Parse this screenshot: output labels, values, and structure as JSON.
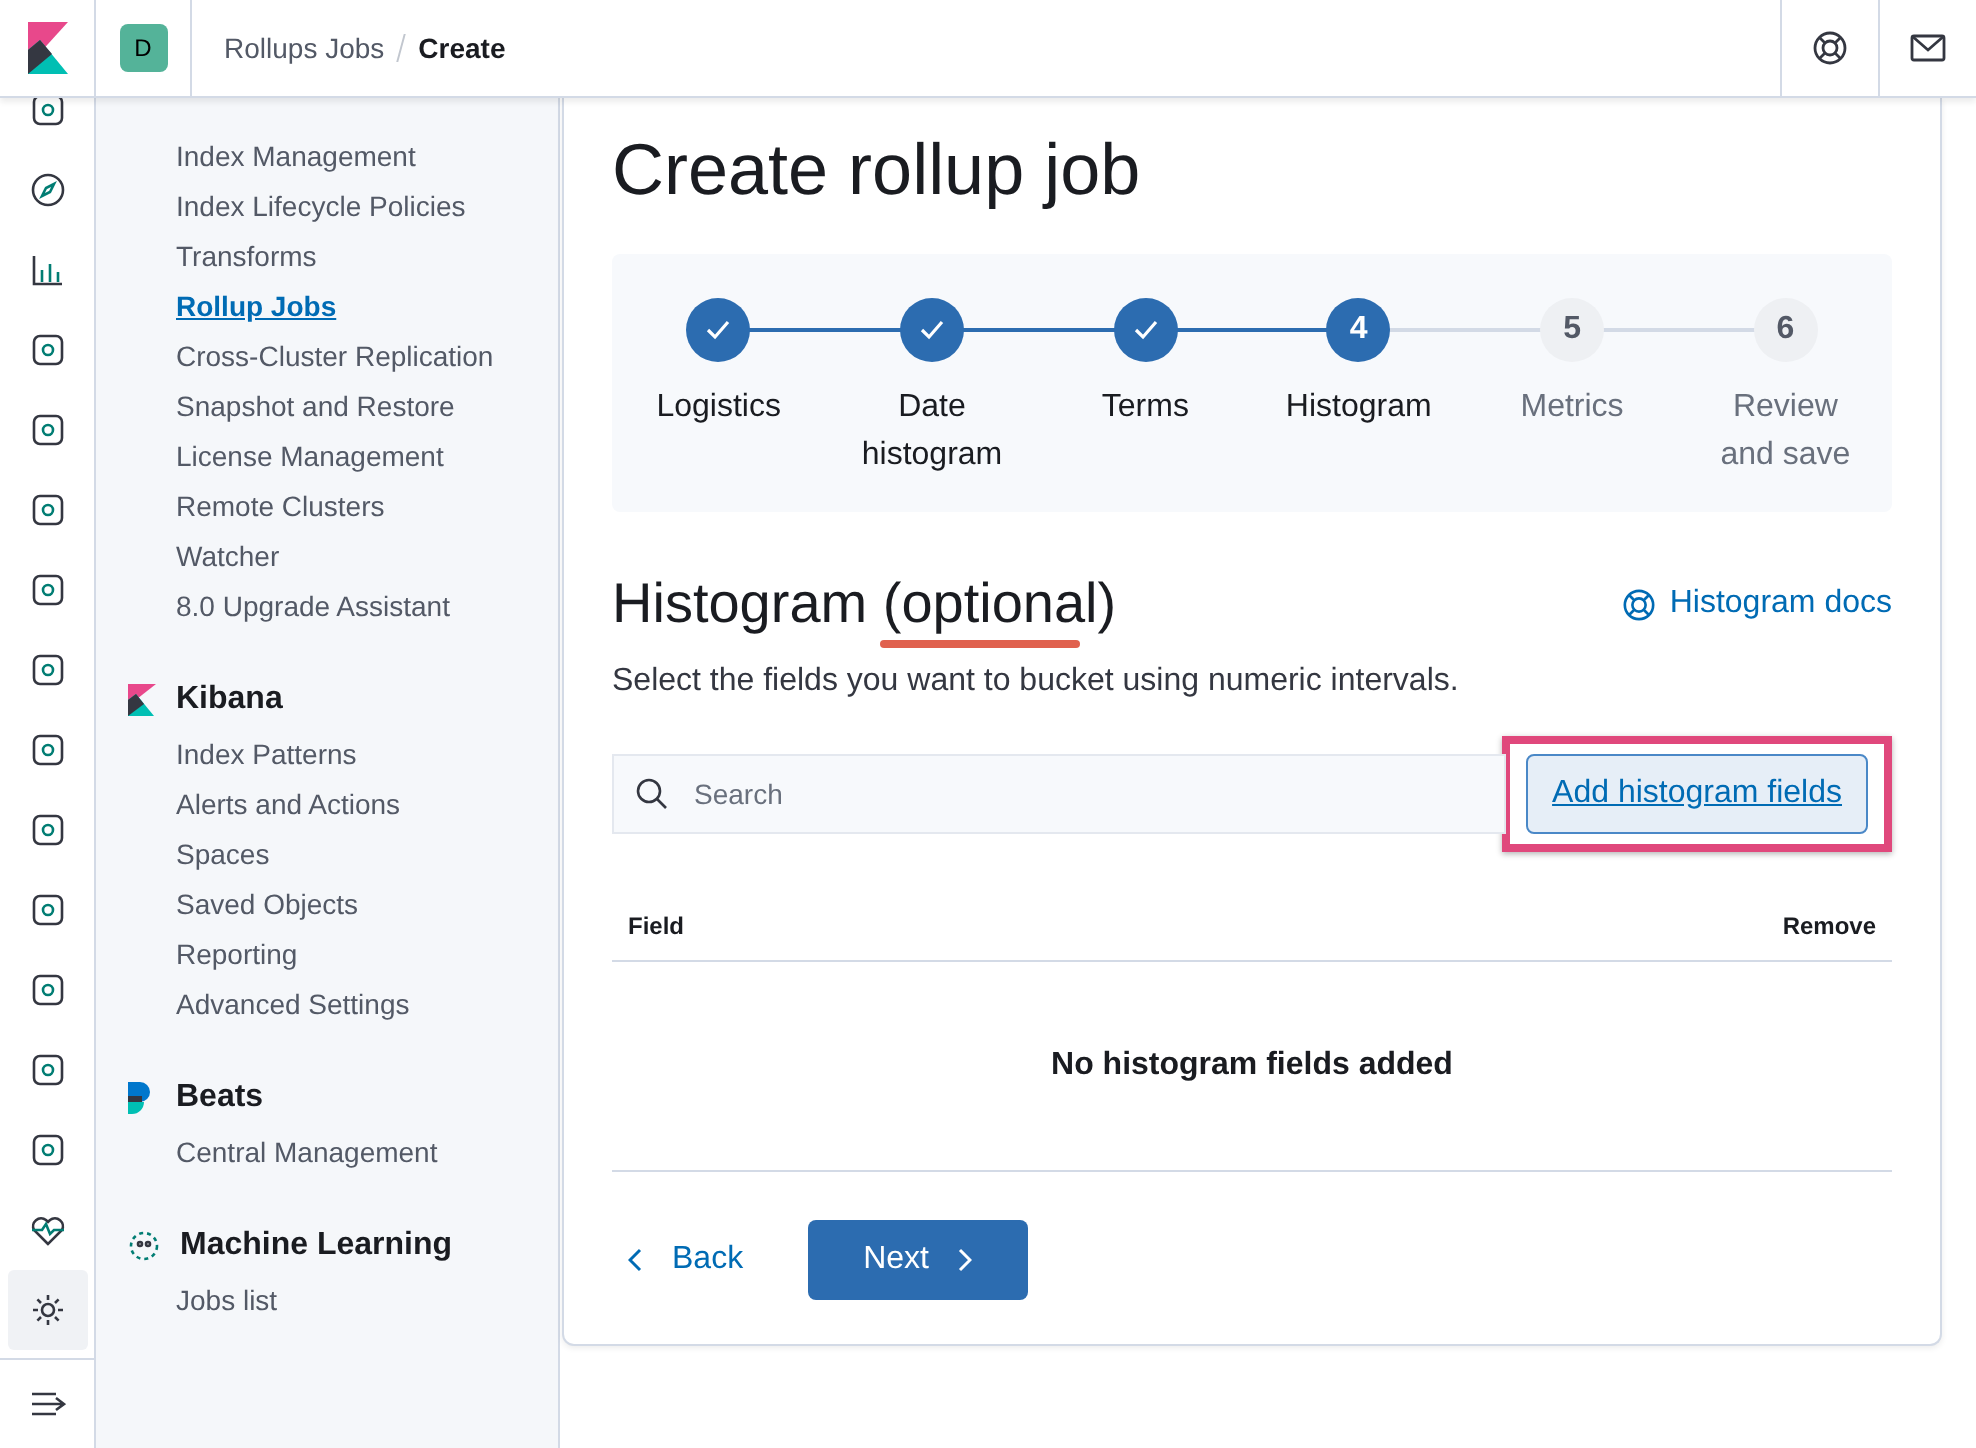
{
  "header": {
    "space_initial": "D",
    "breadcrumbs": [
      {
        "label": "Rollups Jobs",
        "current": false
      },
      {
        "label": "Create",
        "current": true
      }
    ]
  },
  "sidebar": {
    "sections": [
      {
        "items": [
          {
            "label": "Index Management",
            "selected": false
          },
          {
            "label": "Index Lifecycle Policies",
            "selected": false
          },
          {
            "label": "Transforms",
            "selected": false
          },
          {
            "label": "Rollup Jobs",
            "selected": true
          },
          {
            "label": "Cross-Cluster Replication",
            "selected": false
          },
          {
            "label": "Snapshot and Restore",
            "selected": false
          },
          {
            "label": "License Management",
            "selected": false
          },
          {
            "label": "Remote Clusters",
            "selected": false
          },
          {
            "label": "Watcher",
            "selected": false
          },
          {
            "label": "8.0 Upgrade Assistant",
            "selected": false
          }
        ]
      },
      {
        "kind": "kibana",
        "title": "Kibana",
        "items": [
          {
            "label": "Index Patterns",
            "selected": false
          },
          {
            "label": "Alerts and Actions",
            "selected": false
          },
          {
            "label": "Spaces",
            "selected": false
          },
          {
            "label": "Saved Objects",
            "selected": false
          },
          {
            "label": "Reporting",
            "selected": false
          },
          {
            "label": "Advanced Settings",
            "selected": false
          }
        ]
      },
      {
        "kind": "beats",
        "title": "Beats",
        "items": [
          {
            "label": "Central Management",
            "selected": false
          }
        ]
      },
      {
        "kind": "ml",
        "title": "Machine Learning",
        "items": [
          {
            "label": "Jobs list",
            "selected": false
          }
        ]
      }
    ]
  },
  "page": {
    "title": "Create rollup job",
    "steps": [
      {
        "label": "Logistics",
        "complete": true
      },
      {
        "label": "Date histogram",
        "complete": true
      },
      {
        "label": "Terms",
        "complete": true
      },
      {
        "label": "Histogram",
        "number": "4",
        "complete": false,
        "current": true
      },
      {
        "label": "Metrics",
        "number": "5",
        "complete": false,
        "current": false
      },
      {
        "label": "Review and save",
        "number": "6",
        "complete": false,
        "current": false
      }
    ],
    "section_title": "Histogram (optional)",
    "docs_link": "Histogram docs",
    "description": "Select the fields you want to bucket using numeric intervals.",
    "search": {
      "placeholder": "Search"
    },
    "add_button": "Add histogram fields",
    "table": {
      "columns": [
        "Field",
        "Remove"
      ],
      "empty_message": "No histogram fields added"
    },
    "back_button": "Back",
    "next_button": "Next"
  }
}
